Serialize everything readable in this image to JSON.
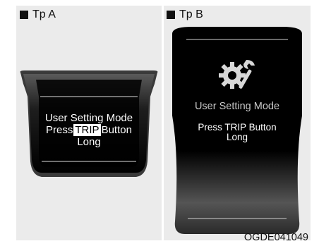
{
  "type_a": {
    "label": "Tp A",
    "line1": "User Setting Mode",
    "line2_before": "Press",
    "line2_highlight": "TRIP",
    "line2_after": "Button",
    "line3": "Long"
  },
  "type_b": {
    "label": "Tp B",
    "mode_text": "User Setting Mode",
    "line1": "Press TRIP Button",
    "line2": "Long",
    "icon": "gear-wrench-icon"
  },
  "figure_code": "OGDE041049",
  "colors": {
    "panel_bg": "#ebebeb",
    "display_black": "#000000",
    "display_grey": "#4a4a4a"
  }
}
